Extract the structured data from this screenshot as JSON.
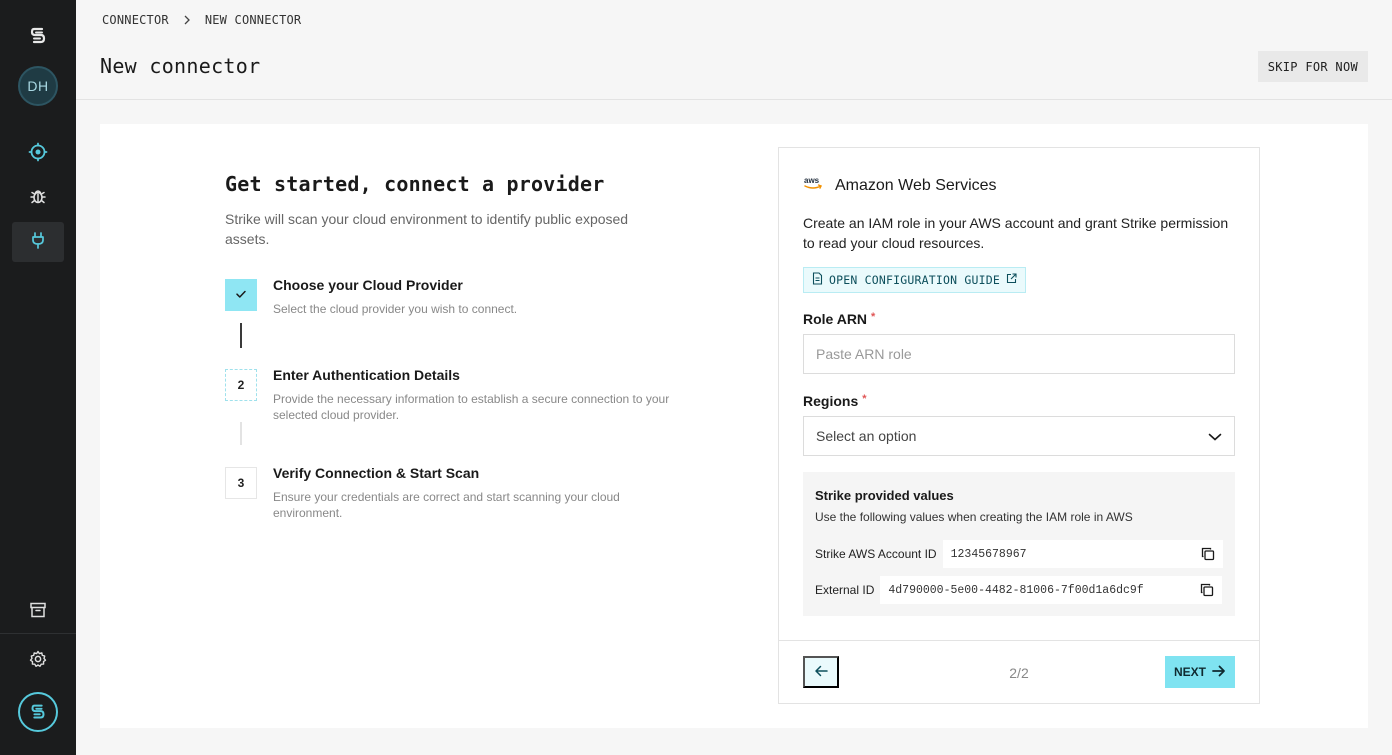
{
  "sidebar": {
    "avatar_initials": "DH",
    "items": [
      {
        "name": "assets",
        "icon": "target-icon"
      },
      {
        "name": "vulnerabilities",
        "icon": "bug-icon"
      },
      {
        "name": "connectors",
        "icon": "plug-icon",
        "active": true
      }
    ],
    "bottom_items": [
      {
        "name": "archive",
        "icon": "archive-icon"
      },
      {
        "name": "settings",
        "icon": "gear-icon"
      }
    ]
  },
  "header": {
    "breadcrumb": [
      "CONNECTOR",
      "NEW CONNECTOR"
    ],
    "title": "New connector",
    "skip_label": "SKIP FOR NOW"
  },
  "intro": {
    "title": "Get started, connect a provider",
    "subtitle": "Strike will scan your cloud environment to identify public exposed assets."
  },
  "steps": [
    {
      "number": "",
      "status": "done",
      "title": "Choose your Cloud Provider",
      "description": "Select the cloud provider you wish to connect."
    },
    {
      "number": "2",
      "status": "current",
      "title": "Enter Authentication Details",
      "description": "Provide the necessary information to establish a secure connection to your selected cloud provider."
    },
    {
      "number": "3",
      "status": "todo",
      "title": "Verify Connection & Start Scan",
      "description": "Ensure your credentials are correct and start scanning your cloud environment."
    }
  ],
  "card": {
    "provider_logo_text": "aws",
    "provider_name": "Amazon Web Services",
    "description": "Create an IAM role in your AWS account and grant Strike permission to read your cloud resources.",
    "guide_label": "OPEN CONFIGURATION GUIDE",
    "role_arn": {
      "label": "Role ARN",
      "required_mark": "*",
      "placeholder": "Paste ARN role",
      "value": ""
    },
    "regions": {
      "label": "Regions",
      "required_mark": "*",
      "selected": "Select an option"
    },
    "provided_values": {
      "title": "Strike provided values",
      "subtitle": "Use the following values when creating the IAM role in AWS",
      "account_id_label": "Strike AWS Account ID",
      "account_id_value": "12345678967",
      "external_id_label": "External ID",
      "external_id_value": "4d790000-5e00-4482-81006-7f00d1a6dc9f"
    },
    "pager": "2/2",
    "next_label": "NEXT"
  },
  "colors": {
    "sidebar_bg": "#1b1c1d",
    "accent": "#7fe3f1",
    "accent_light": "#eafafc",
    "icon_accent": "#56c9dc"
  }
}
